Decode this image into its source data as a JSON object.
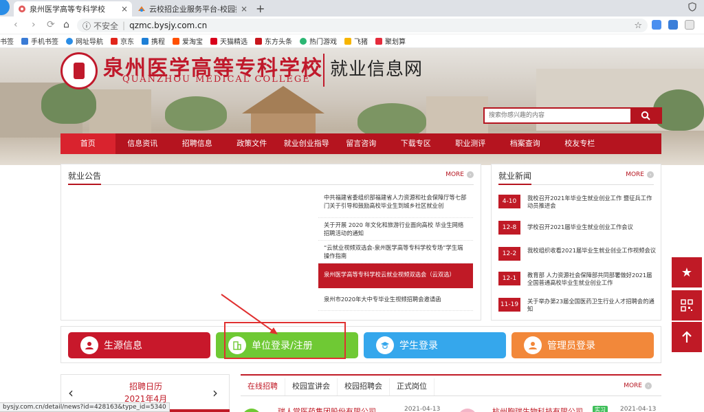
{
  "browser": {
    "tabs": [
      {
        "title": "泉州医学高等专科学校",
        "close": "×",
        "active": true
      },
      {
        "title": "云校招企业服务平台-校园招聘|校",
        "close": "×",
        "active": false
      }
    ],
    "new_tab": "+",
    "security_label": "不安全",
    "url": "qzmc.bysjy.com.cn",
    "bookmarks": [
      "书签",
      "手机书签",
      "网址导航",
      "京东",
      "携程",
      "爱淘宝",
      "天猫精选",
      "东方头条",
      "热门游戏",
      "飞猪",
      "聚划算"
    ]
  },
  "site": {
    "name_cn": "泉州医学高等专科学校",
    "name_en": "QUANZHOU MEDICAL COLLEGE",
    "subtitle": "就业信息网",
    "search_placeholder": "搜索你感兴趣的内容",
    "nav": [
      "首页",
      "信息资讯",
      "招聘信息",
      "政策文件",
      "就业创业指导",
      "留言咨询",
      "下载专区",
      "职业测评",
      "档案查询",
      "校友专栏"
    ]
  },
  "announcements": {
    "title": "就业公告",
    "more": "MORE",
    "items": [
      "中共福建省委组织部福建省人力资源和社会保障厅等七部门关于引导和鼓励高校毕业生到城乡社区就业创",
      "关于开展 2020 年文化和旅游行业面向高校 毕业生网络招聘活动的通知",
      "“云就业视频双选会-泉州医学高等专科学校专场”学生端操作指南",
      "泉州医学高等专科学校云就业视频双选会（云双选）",
      "泉州市2020年大中专毕业生视频招聘会邀请函"
    ]
  },
  "news": {
    "title": "就业新闻",
    "more": "MORE",
    "items": [
      {
        "date": "4-10",
        "text": "我校召开2021年毕业生就业创业工作 暨征兵工作动员推进会"
      },
      {
        "date": "12-8",
        "text": "学校召开2021届毕业生就业创业工作会议"
      },
      {
        "date": "12-2",
        "text": "我校组织收看2021届毕业生就业创业工作视频会议"
      },
      {
        "date": "12-1",
        "text": "教育部 人力资源社会保障部共同部署做好2021届全国普通高校毕业生就业创业工作"
      },
      {
        "date": "11-19",
        "text": "关于举办第23届全国医药卫生行业人才招聘会的通知"
      }
    ]
  },
  "logins": [
    {
      "label": "生源信息",
      "color": "#c8182b"
    },
    {
      "label": "单位登录/注册",
      "color": "#6fc934"
    },
    {
      "label": "学生登录",
      "color": "#35a7ec"
    },
    {
      "label": "管理员登录",
      "color": "#f2883a"
    }
  ],
  "calendar": {
    "title": "招聘日历",
    "month": "2021年4月",
    "prev": "‹",
    "next": "›"
  },
  "recruit": {
    "tabs": [
      "在线招聘",
      "校园宣讲会",
      "校园招聘会",
      "正式岗位"
    ],
    "more": "MORE",
    "rows": [
      {
        "company": "瑞人堂医药集团股份有限公司",
        "date": "2021-04-13"
      },
      {
        "company": "杭州胸瑞生物科技有限公司",
        "tag": "实习",
        "date": "2021-04-13"
      }
    ]
  },
  "status_url": "bysjy.com.cn/detail/news?id=428163&type_id=5340"
}
